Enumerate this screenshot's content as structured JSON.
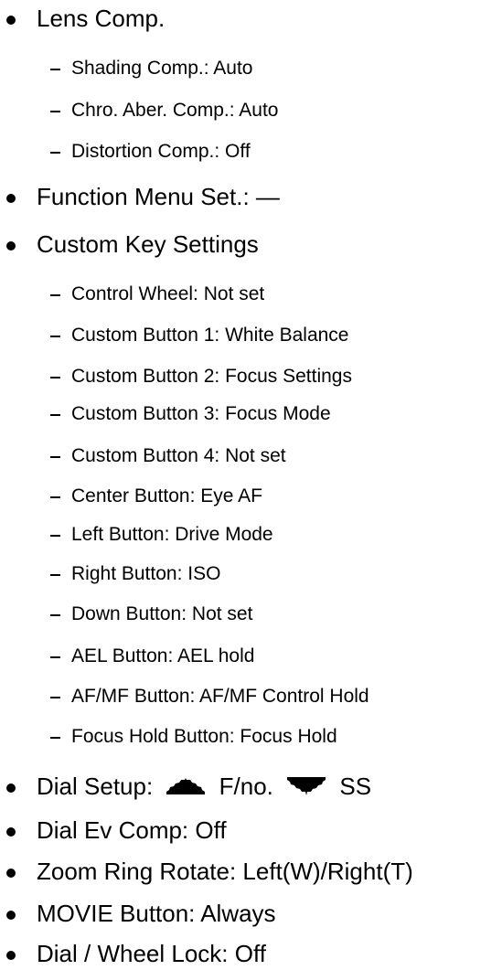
{
  "items": [
    {
      "label": "Lens Comp.",
      "subitems": [
        "Shading Comp.: Auto",
        "Chro. Aber. Comp.: Auto",
        "Distortion Comp.: Off"
      ]
    },
    {
      "label": "Function Menu Set.: —"
    },
    {
      "label": "Custom Key Settings",
      "subitems": [
        "Control Wheel: Not set",
        "Custom Button 1: White Balance",
        "Custom Button 2: Focus Settings",
        "Custom Button 3: Focus Mode",
        "Custom Button 4: Not set",
        "Center Button: Eye AF",
        "Left Button: Drive Mode",
        "Right Button: ISO",
        "Down Button: Not set",
        "AEL Button: AEL hold",
        "AF/MF Button: AF/MF Control Hold",
        "Focus Hold Button: Focus Hold"
      ]
    }
  ],
  "dial_setup": {
    "label": "Dial Setup:",
    "front_value": "F/no.",
    "rear_value": "SS",
    "front_icon": "front-dial-icon",
    "rear_icon": "rear-dial-icon"
  },
  "items_after": [
    {
      "label": "Dial Ev Comp: Off"
    },
    {
      "label": "Zoom Ring Rotate: Left(W)/Right(T)"
    },
    {
      "label": "MOVIE Button: Always"
    },
    {
      "label": "Dial / Wheel Lock: Off"
    }
  ]
}
